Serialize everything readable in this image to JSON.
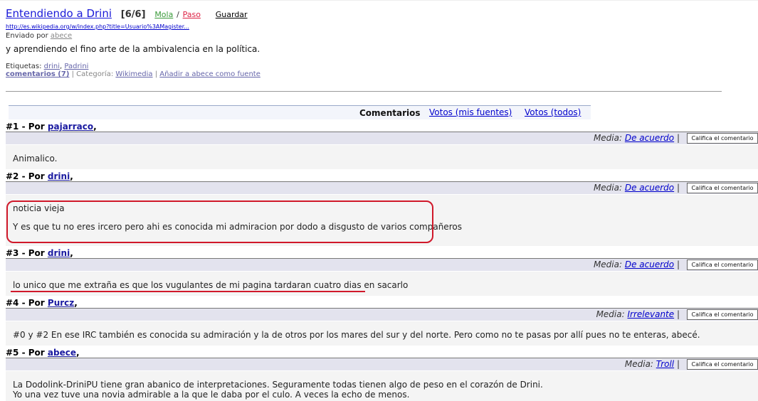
{
  "story": {
    "title": "Entendiendo a Drini",
    "count": "[6/6]",
    "mola": "Mola",
    "vote_sep": "/",
    "paso": "Paso",
    "guardar": "Guardar",
    "url": "http://es.wikipedia.org/w/index.php?title=Usuario%3AMagister...",
    "sent_by_label": "Enviado por",
    "sent_by_user": "abece",
    "description": "y aprendiendo el fino arte de la ambivalencia en la política.",
    "tags_label": "Etiquetas:",
    "tags": [
      "drini",
      "Padrini"
    ],
    "comments_link": "comentarios (7)",
    "category_label": "Categoría:",
    "category": "Wikimedia",
    "add_source": "Añadir a abece como fuente"
  },
  "tabs": {
    "active": "Comentarios",
    "votes_mine": "Votos (mis fuentes)",
    "votes_all": "Votos (todos)"
  },
  "common": {
    "media_label": "Media:",
    "rate_button": "Califica el comentario",
    "by": "Por"
  },
  "comments": [
    {
      "num": "#1 -",
      "user": "pajarraco",
      "media": "De acuerdo",
      "lines": [
        "Animalico."
      ]
    },
    {
      "num": "#2 -",
      "user": "drini",
      "media": "De acuerdo",
      "lines": [
        "noticia vieja",
        "Y es que tu no eres ircero pero ahi es conocida mi admiracion por dodo a disgusto de varios compañeros"
      ]
    },
    {
      "num": "#3 -",
      "user": "drini",
      "media": "De acuerdo",
      "lines": [
        "lo unico que me extraña es que los vugulantes de mi pagina tardaran cuatro dias en sacarlo"
      ]
    },
    {
      "num": "#4 -",
      "user": "Purcz",
      "media": "Irrelevante",
      "lines": [
        "#0 y #2 En ese IRC también es conocida su admiración y la de otros por los mares del sur y del norte. Pero como no te pasas por allí pues no te enteras, abecé."
      ]
    },
    {
      "num": "#5 -",
      "user": "abece",
      "media": "Troll",
      "lines": [
        "La Dodolink-DriniPU tiene gran abanico de interpretaciones. Seguramente todas tienen algo de peso en el corazón de Drini.",
        "Yo una vez tuve una novia admirable a la que le daba por el culo. A veces la echo de menos."
      ]
    }
  ]
}
